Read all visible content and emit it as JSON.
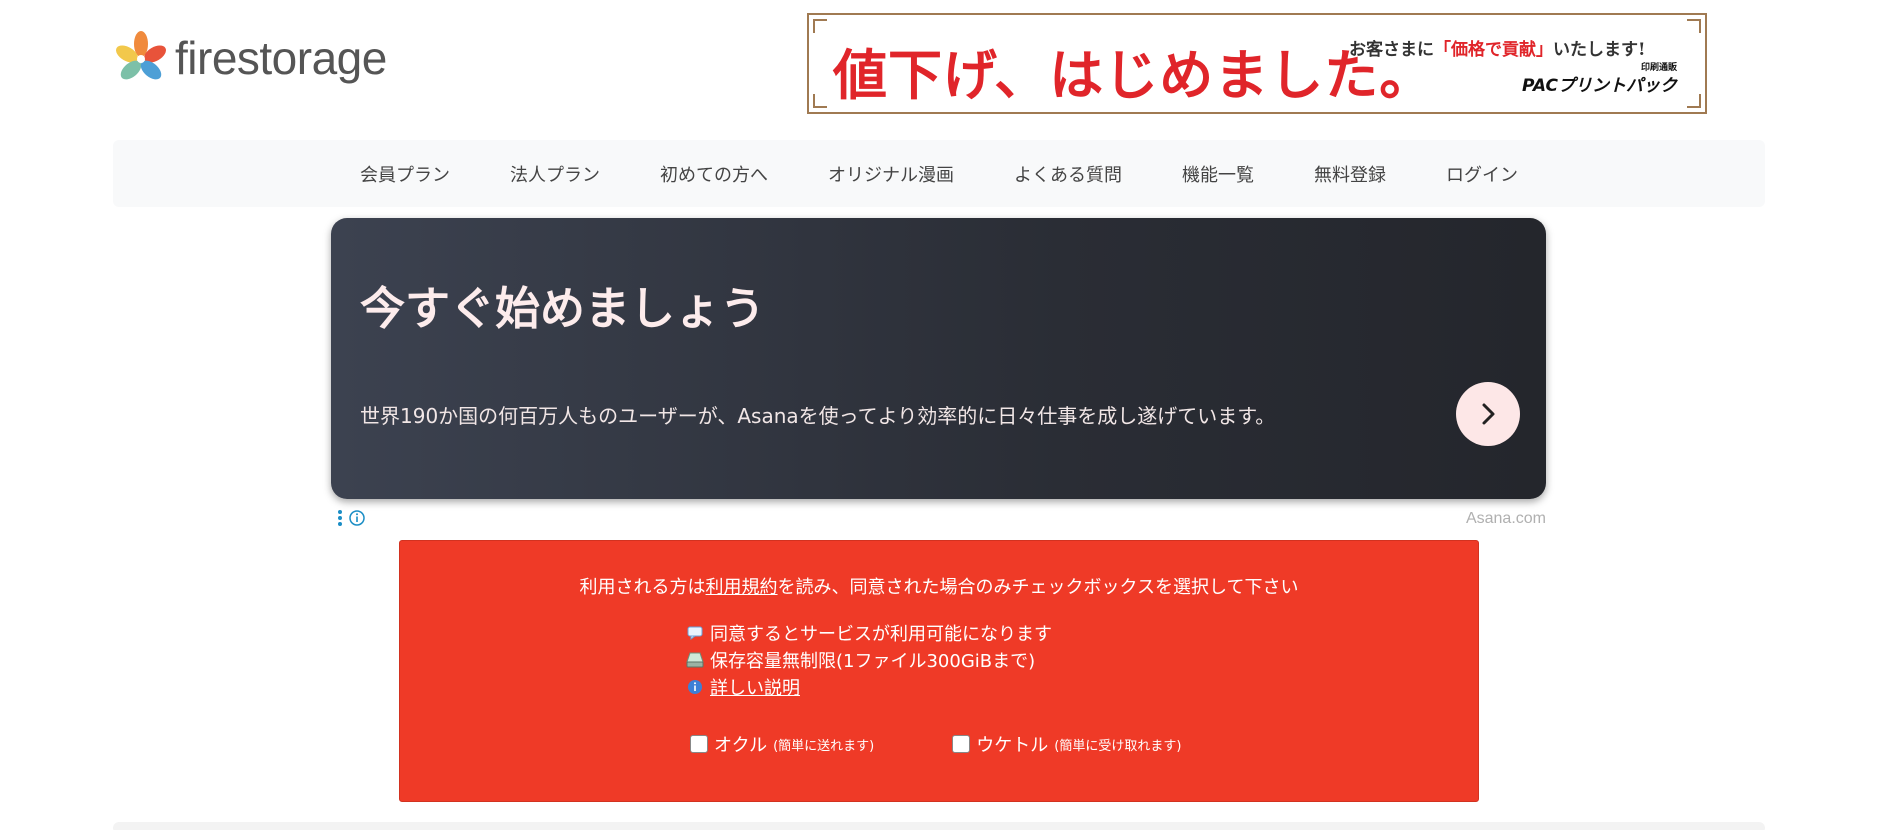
{
  "header": {
    "logo_text": "firestorage",
    "logo_icon": "flower-logo-icon"
  },
  "top_banner": {
    "headline": "値下げ、はじめました。",
    "sub_prefix": "お客さまに",
    "sub_highlight": "「価格で貢献」",
    "sub_suffix": "いたします!",
    "brand_small": "印刷通販",
    "brand": "プリントパック",
    "brand_mark": "PAC",
    "border_color": "#a07a52",
    "headline_color": "#e0252a"
  },
  "nav": {
    "items": [
      {
        "label": "会員プラン"
      },
      {
        "label": "法人プラン"
      },
      {
        "label": "初めての方へ"
      },
      {
        "label": "オリジナル漫画"
      },
      {
        "label": "よくある質問"
      },
      {
        "label": "機能一覧"
      },
      {
        "label": "無料登録"
      },
      {
        "label": "ログイン"
      }
    ]
  },
  "ad": {
    "title": "今すぐ始めましょう",
    "description": "世界190か国の何百万人ものユーザーが、Asanaを使ってより効率的に日々仕事を成し遂げています。",
    "next_icon": "chevron-right-icon",
    "options_icon": "kebab-menu-icon",
    "info_icon": "info-icon",
    "domain": "Asana.com"
  },
  "consent": {
    "title_prefix": "利用される方は",
    "title_link": "利用規約",
    "title_suffix": "を読み、同意された場合のみチェックボックスを選択して下さい",
    "bg_color": "#ef3a27",
    "features": [
      {
        "icon": "speech-bubble-icon",
        "text": "同意するとサービスが利用可能になります"
      },
      {
        "icon": "storage-drive-icon",
        "text": "保存容量無制限(1ファイル300GiBまで)"
      },
      {
        "icon": "info-icon",
        "text": "詳しい説明"
      }
    ],
    "choices": [
      {
        "label": "オクル",
        "note": "(簡単に送れます)",
        "checked": false
      },
      {
        "label": "ウケトル",
        "note": "(簡単に受け取れます)",
        "checked": false
      }
    ]
  }
}
